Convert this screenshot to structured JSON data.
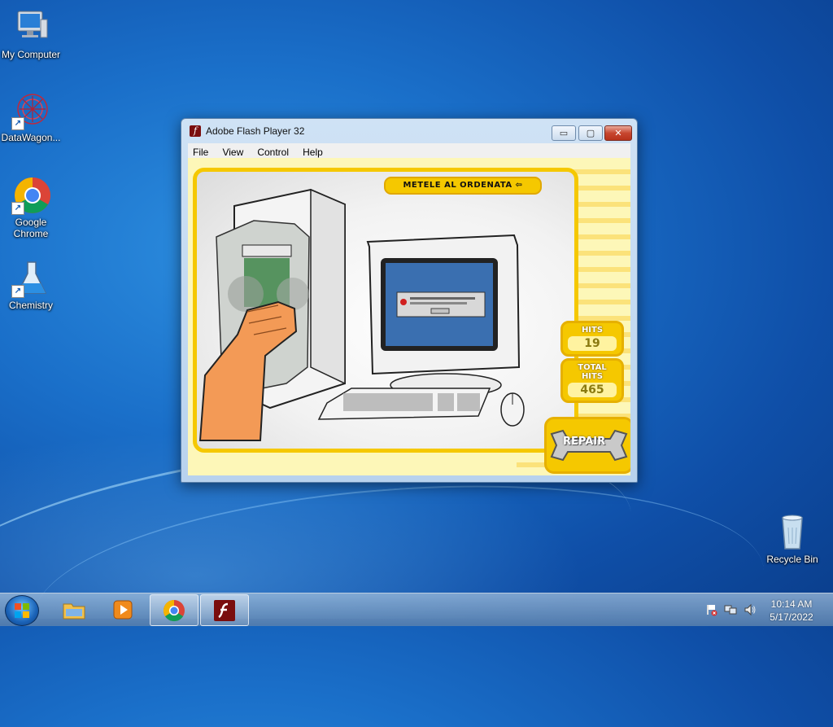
{
  "desktop": {
    "icons": [
      {
        "label": "My Computer",
        "icon": "computer-icon"
      },
      {
        "label": "DataWagon...",
        "icon": "datawagon-icon"
      },
      {
        "label": "Google Chrome",
        "icon": "chrome-icon"
      },
      {
        "label": "Chemistry",
        "icon": "flask-icon"
      },
      {
        "label": "Recycle Bin",
        "icon": "recycle-bin-icon"
      }
    ]
  },
  "window": {
    "title": "Adobe Flash Player 32",
    "menu": [
      "File",
      "View",
      "Control",
      "Help"
    ],
    "controls": {
      "minimize": "▭",
      "maximize": "▢",
      "close": "✕"
    }
  },
  "game": {
    "banner": "METELE AL ORDENATA",
    "banner_arrow": "⇦",
    "hits_label": "HITS",
    "hits_value": "19",
    "total_label_1": "TOTAL",
    "total_label_2": "HITS",
    "total_value": "465",
    "repair_label": "REPAIR"
  },
  "taskbar": {
    "time": "10:14 AM",
    "date": "5/17/2022",
    "pinned": [
      "explorer-icon",
      "media-player-icon",
      "chrome-icon",
      "flash-icon"
    ]
  },
  "colors": {
    "flash_yellow": "#f5c800",
    "desktop_blue": "#1a6fc9"
  }
}
